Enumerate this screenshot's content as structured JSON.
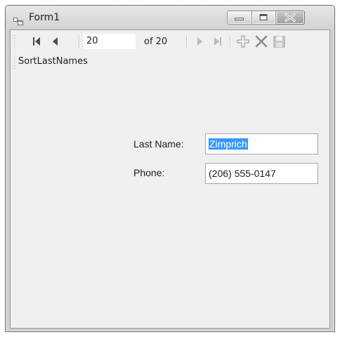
{
  "window": {
    "title": "Form1"
  },
  "binding_navigator": {
    "position_value": "20",
    "count_label": "of 20",
    "buttons": [
      "move-first-icon",
      "move-previous-icon",
      "move-next-icon",
      "move-last-icon",
      "add-new-icon",
      "delete-icon",
      "save-icon"
    ]
  },
  "menu": {
    "items": [
      "SortLastNames"
    ]
  },
  "form": {
    "last_name_label": "Last Name:",
    "last_name_value": "Zimprich",
    "phone_label": "Phone:",
    "phone_value": "(206) 555-0147"
  },
  "colors": {
    "selection": "#3399ff",
    "client_bg": "#f0f0f0",
    "close_button": "#a8a8a8"
  }
}
